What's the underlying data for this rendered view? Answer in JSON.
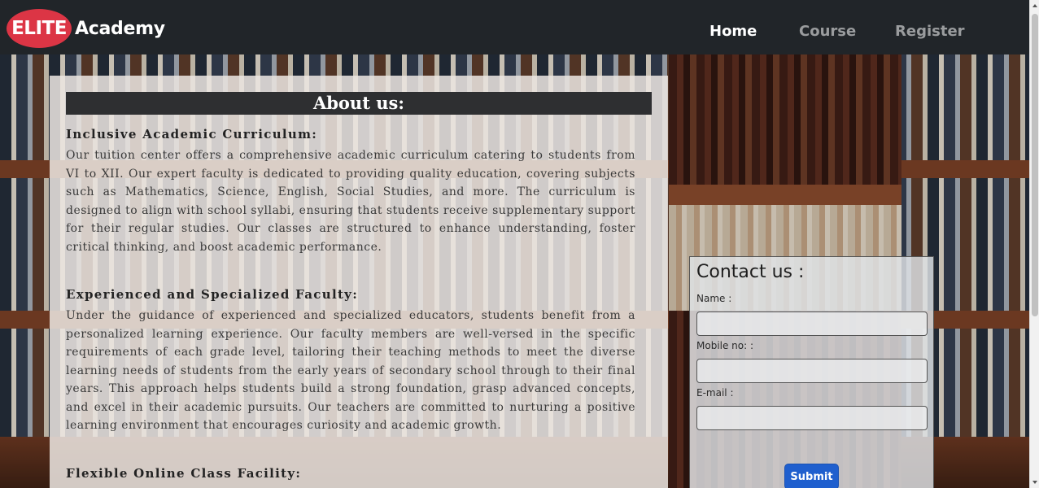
{
  "navbar": {
    "brand_badge": "ELITE",
    "brand_name": "Academy",
    "links": [
      {
        "label": "Home",
        "active": true
      },
      {
        "label": "Course",
        "active": false
      },
      {
        "label": "Register",
        "active": false
      }
    ]
  },
  "about": {
    "title": "About us:",
    "sections": [
      {
        "heading": "Inclusive Academic Curriculum:",
        "body": "Our tuition center offers a comprehensive academic curriculum catering to students from VI to XII. Our expert faculty is dedicated to providing quality education, covering subjects such as Mathematics, Science, English, Social Studies, and more. The curriculum is designed to align with school syllabi, ensuring that students receive supplementary support for their regular studies. Our classes are structured to enhance understanding, foster critical thinking, and boost academic performance."
      },
      {
        "heading": "Experienced and Specialized Faculty:",
        "body": "Under the guidance of experienced and specialized educators, students benefit from a personalized learning experience. Our faculty members are well-versed in the specific requirements of each grade level, tailoring their teaching methods to meet the diverse learning needs of students from the early years of secondary school through to their final years. This approach helps students build a strong foundation, grasp advanced concepts, and excel in their academic pursuits. Our teachers are committed to nurturing a positive learning environment that encourages curiosity and academic growth."
      },
      {
        "heading": "Flexible Online Class Facility:",
        "body": ""
      }
    ]
  },
  "contact": {
    "title": "Contact us :",
    "fields": [
      {
        "label": "Name :",
        "value": "",
        "placeholder": ""
      },
      {
        "label": "Mobile no: :",
        "value": "",
        "placeholder": ""
      },
      {
        "label": "E-mail :",
        "value": "",
        "placeholder": ""
      }
    ],
    "submit_label": "Submit"
  },
  "colors": {
    "navbar_bg": "#212529",
    "brand_badge": "#dc3545",
    "submit_button": "#1f5fce",
    "about_title_bar": "#2e2f31"
  }
}
